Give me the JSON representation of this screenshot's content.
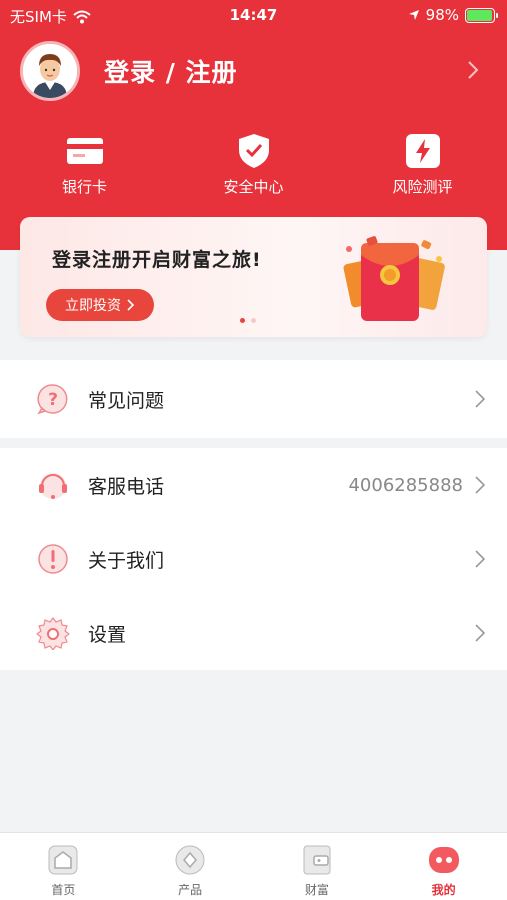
{
  "status_bar": {
    "carrier": "无SIM卡",
    "time": "14:47",
    "battery": "98%",
    "battery_level": 0.98
  },
  "profile": {
    "login_label": "登录 / 注册"
  },
  "quick_actions": [
    {
      "label": "银行卡",
      "icon": "bank-card-icon"
    },
    {
      "label": "安全中心",
      "icon": "shield-check-icon"
    },
    {
      "label": "风险测评",
      "icon": "lightning-icon"
    }
  ],
  "banner": {
    "title": "登录注册开启财富之旅!",
    "button_label": "立即投资",
    "page_index": 1,
    "page_count": 2
  },
  "menu": [
    {
      "label": "常见问题",
      "icon": "question-icon"
    },
    {
      "label": "客服电话",
      "icon": "headset-icon",
      "value": "4006285888"
    },
    {
      "label": "关于我们",
      "icon": "exclamation-icon"
    },
    {
      "label": "设置",
      "icon": "gear-icon"
    }
  ],
  "tabs": [
    {
      "label": "首页",
      "icon": "home-icon"
    },
    {
      "label": "产品",
      "icon": "product-icon"
    },
    {
      "label": "财富",
      "icon": "wallet-icon"
    },
    {
      "label": "我的",
      "icon": "profile-icon",
      "active": true
    }
  ],
  "colors": {
    "brand_red": "#e8323b",
    "background": "#f2f3f5"
  }
}
